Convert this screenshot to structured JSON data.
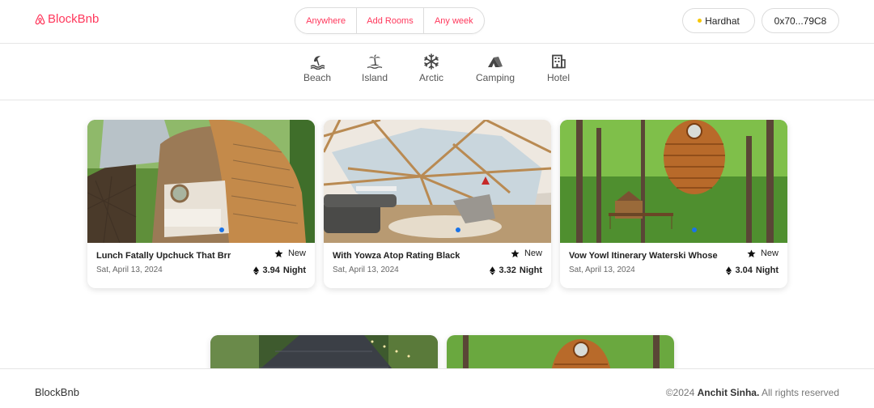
{
  "header": {
    "brand": "BlockBnb",
    "search": {
      "location": "Anywhere",
      "rooms": "Add Rooms",
      "dates": "Any week"
    },
    "network_label": "Hardhat",
    "account_label": "0x70...79C8"
  },
  "categories": [
    {
      "label": "Beach",
      "icon": "beach-icon"
    },
    {
      "label": "Island",
      "icon": "island-icon"
    },
    {
      "label": "Arctic",
      "icon": "snowflake-icon"
    },
    {
      "label": "Camping",
      "icon": "tent-icon"
    },
    {
      "label": "Hotel",
      "icon": "building-icon"
    }
  ],
  "listings": [
    {
      "title": "Lunch Fatally Upchuck That Brr",
      "date": "Sat, April 13, 2024",
      "badge": "New",
      "price": "3.94",
      "unit": "Night"
    },
    {
      "title": "With Yowza Atop Rating Black",
      "date": "Sat, April 13, 2024",
      "badge": "New",
      "price": "3.32",
      "unit": "Night"
    },
    {
      "title": "Vow Yowl Itinerary Waterski Whose",
      "date": "Sat, April 13, 2024",
      "badge": "New",
      "price": "3.04",
      "unit": "Night"
    }
  ],
  "footer": {
    "brand": "BlockBnb",
    "copyright_prefix": "©2024",
    "author": "Anchit Sinha.",
    "rights": "All rights reserved"
  },
  "colors": {
    "accent": "#ff385c",
    "indicator": "#1a73e8",
    "network_dot": "#f7c600"
  }
}
